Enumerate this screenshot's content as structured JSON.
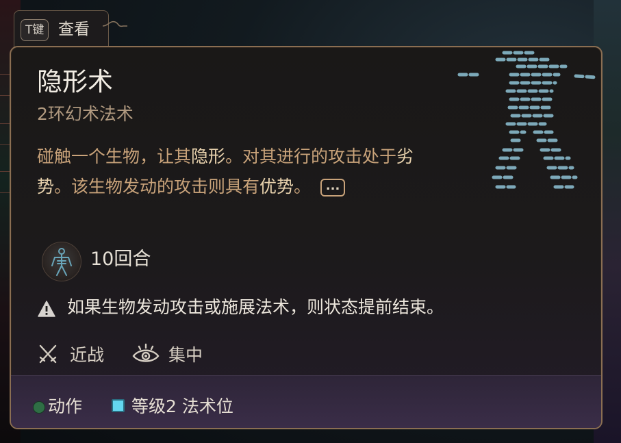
{
  "tab": {
    "key": "T键",
    "label": "查看"
  },
  "spell": {
    "title": "隐形术",
    "subtitle": "2环幻术法术",
    "description": [
      {
        "text": "碰触一个生物，让其",
        "hl": false
      },
      {
        "text": "隐形",
        "hl": true
      },
      {
        "text": "。对其进行的攻击处于",
        "hl": false
      },
      {
        "text": "劣势",
        "hl": true
      },
      {
        "text": "。该生物发动的攻击则具有",
        "hl": false
      },
      {
        "text": "优势",
        "hl": true
      },
      {
        "text": "。",
        "hl": false
      }
    ],
    "more_label": "...",
    "duration": "10回合",
    "warning": "如果生物发动攻击或施展法术，则状态提前结束。",
    "tags": {
      "melee": "近战",
      "concentration": "集中"
    }
  },
  "footer": {
    "action": "动作",
    "slot": "等级2 法术位"
  },
  "colors": {
    "accent_border": "#8a6e52",
    "description": "#c9a37a",
    "highlight": "#e8d2ad",
    "action_dot": "#2f6e45",
    "spell_slot": "#64d6ef"
  },
  "icons": {
    "duration": "invisible-figure-icon",
    "warning": "warning-triangle-icon",
    "melee": "crossed-swords-icon",
    "concentration": "eye-icon",
    "action": "green-dot-icon",
    "slot": "blue-square-icon"
  }
}
